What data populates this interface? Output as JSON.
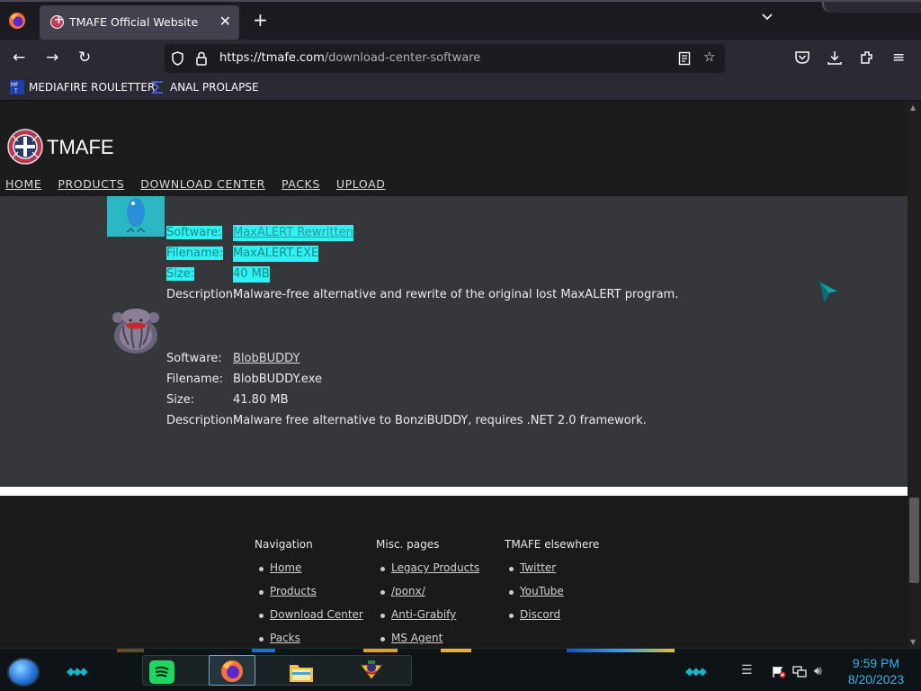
{
  "browser": {
    "tab_title": "TMAFE Official Website",
    "tab_close": "✕",
    "new_tab": "+",
    "tab_list": "⌄",
    "url_host": "https://tmafe.com",
    "url_path": "/download-center-software"
  },
  "bookmarks": [
    {
      "label": "MEDIAFIRE ROULETTER",
      "icon": "mediafire-roulette-icon"
    },
    {
      "label": "ANAL PROLAPSE",
      "icon": "sigma-icon"
    }
  ],
  "site": {
    "logo_text": "TMAFE",
    "menu": [
      "HOME",
      "PRODUCTS",
      "DOWNLOAD CENTER",
      "PACKS",
      "UPLOAD"
    ]
  },
  "software": [
    {
      "icon": "bird-icon",
      "highlighted": true,
      "software_label": "Software:",
      "software": "MaxALERT Rewritten",
      "filename_label": "Filename:",
      "filename": "MaxALERT.EXE",
      "size_label": "Size:",
      "size": "40 MB",
      "description_label": "Description:",
      "description": "Malware-free alternative and rewrite of the original lost MaxALERT program."
    },
    {
      "icon": "blob-icon",
      "highlighted": false,
      "software_label": "Software:",
      "software": "BlobBUDDY",
      "filename_label": "Filename:",
      "filename": "BlobBUDDY.exe",
      "size_label": "Size:",
      "size": "41.80 MB",
      "description_label": "Description:",
      "description": "Malware free alternative to BonziBUDDY, requires .NET 2.0 framework."
    }
  ],
  "footer": {
    "navigation": {
      "title": "Navigation",
      "links": [
        "Home",
        "Products",
        "Download Center",
        "Packs"
      ]
    },
    "misc": {
      "title": "Misc. pages",
      "links": [
        "Legacy Products",
        "/ponx/",
        "Anti-Grabify",
        "MS Agent"
      ]
    },
    "elsewhere": {
      "title": "TMAFE elsewhere",
      "links": [
        "Twitter",
        "YouTube",
        "Discord"
      ]
    }
  },
  "taskbar": {
    "time": "9:59 PM",
    "date": "8/20/2023"
  },
  "colors": {
    "highlight": "#2ff2f2",
    "clock": "#39b4e8",
    "content_bg": "#35373a"
  }
}
